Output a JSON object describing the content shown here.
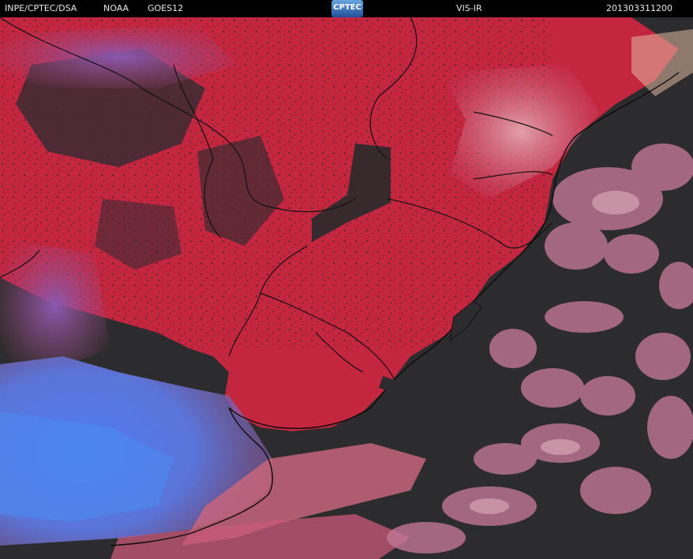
{
  "header": {
    "source": "INPE/CPTEC/DSA",
    "agency": "NOAA",
    "satellite": "GOES12",
    "logo_text": "CPTEC",
    "channel": "VIS-IR",
    "timestamp": "201303311200"
  },
  "colors": {
    "land": "#c4253f",
    "ocean": "#2c2b2d",
    "cloud_high": "#5a7ce8",
    "cloud_low": "#d98fa6"
  }
}
